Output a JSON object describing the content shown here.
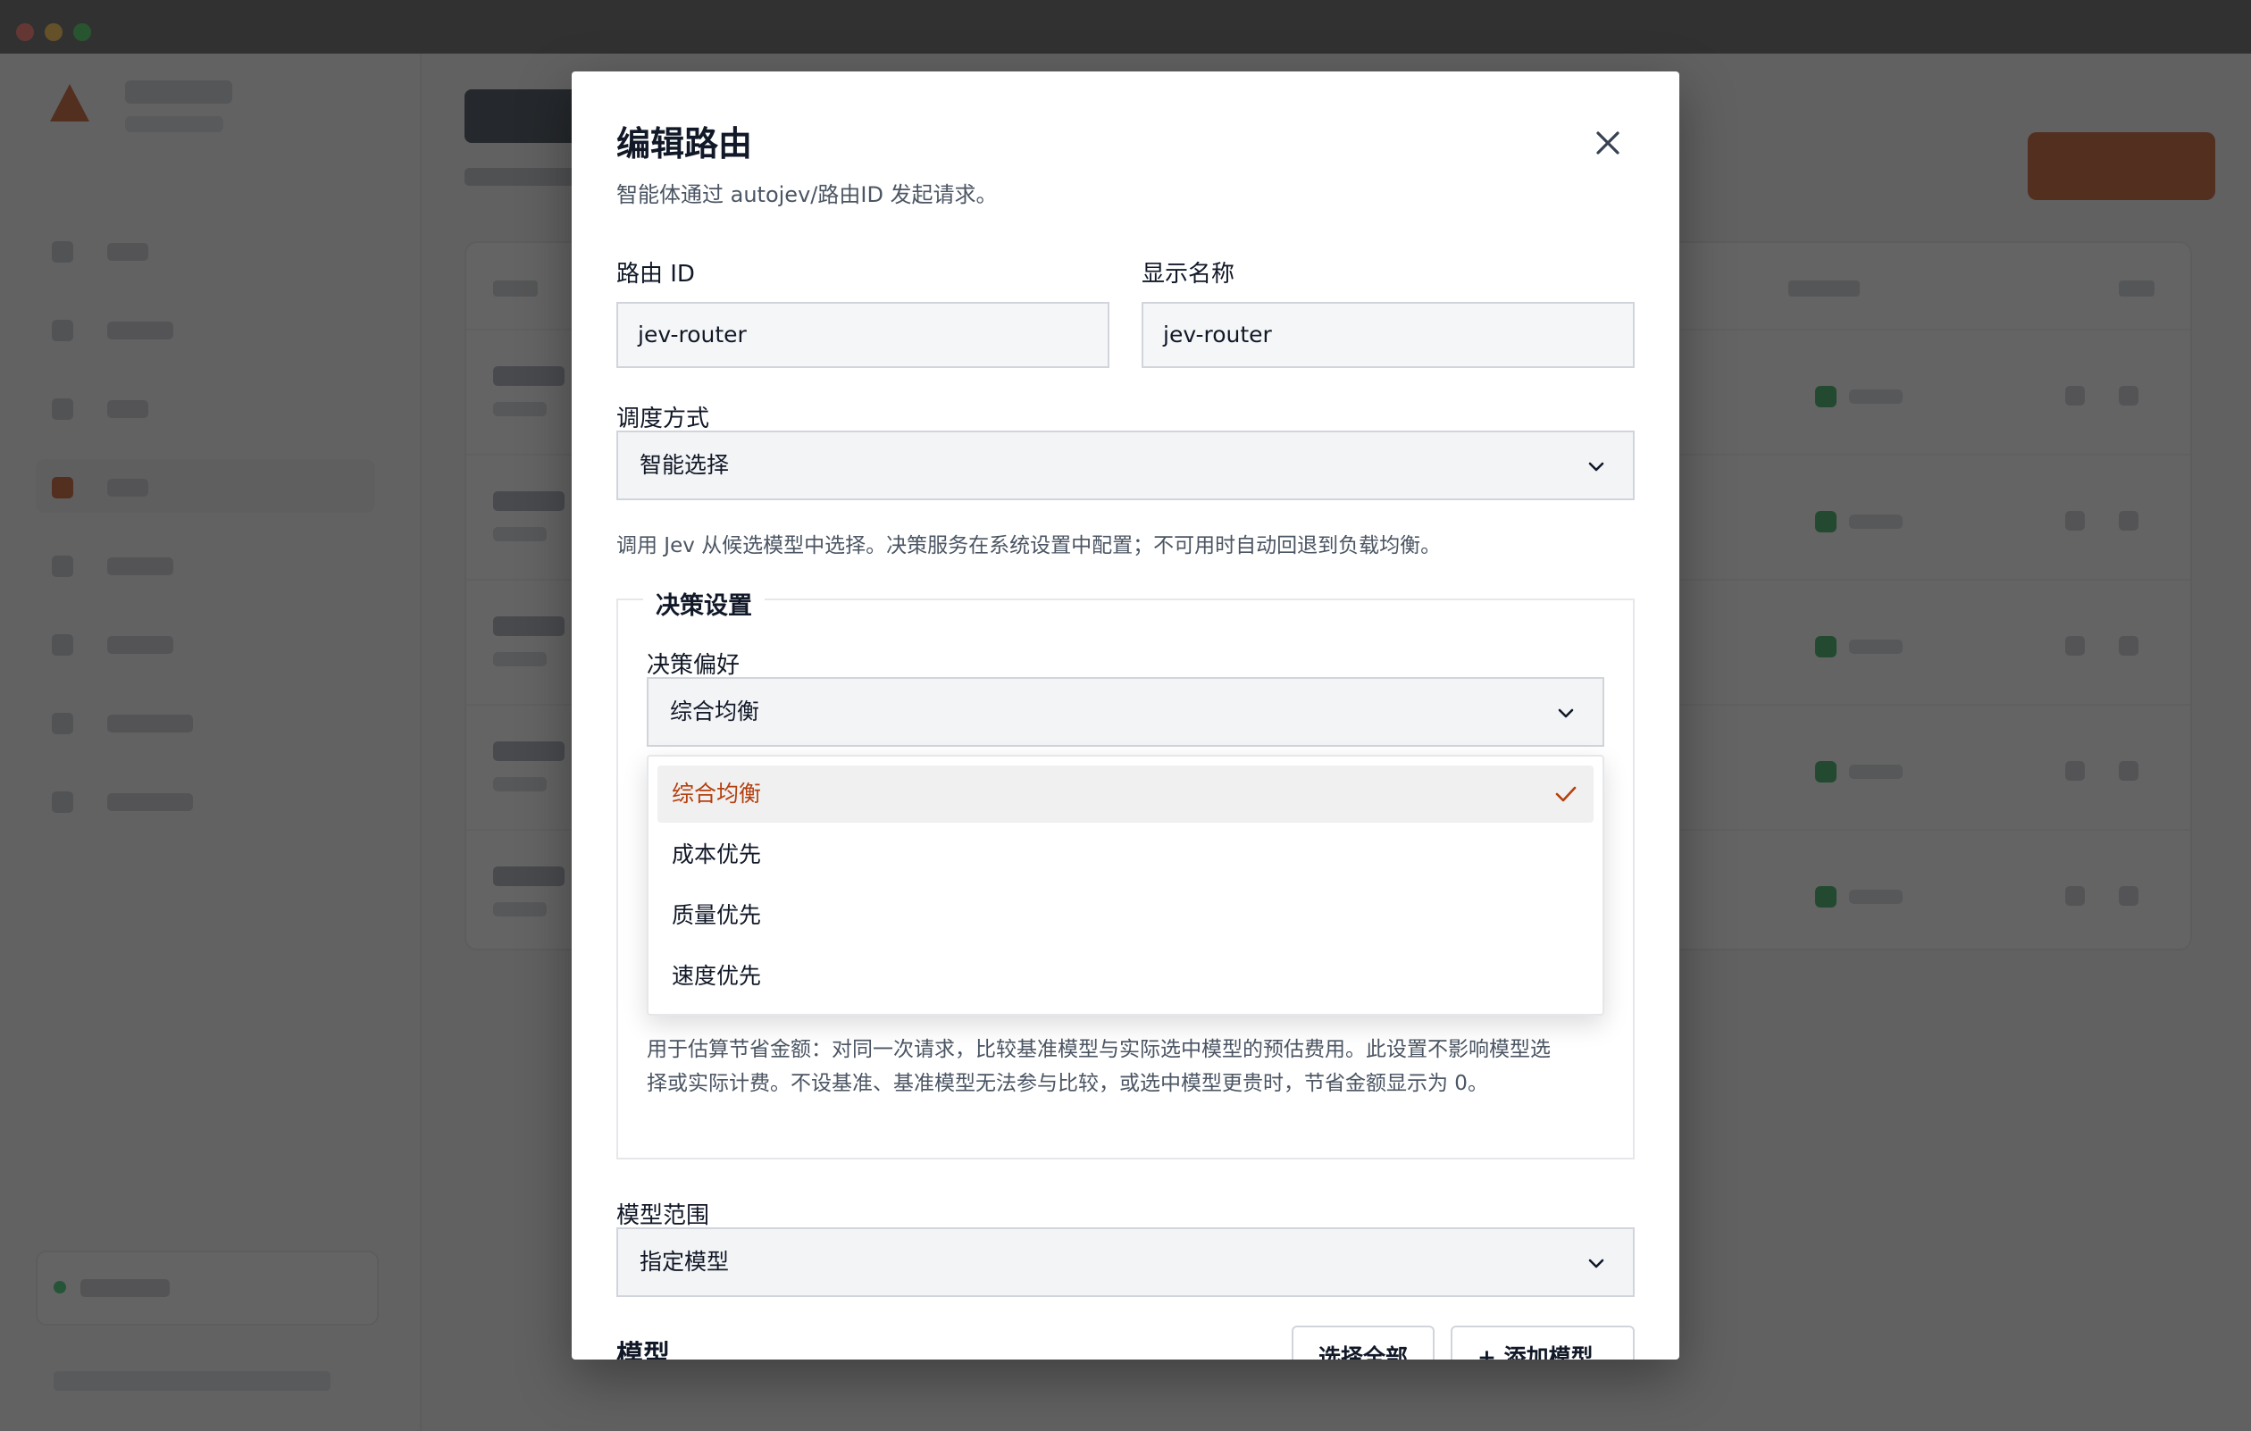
{
  "dialog": {
    "title": "编辑路由",
    "subtitle": "智能体通过 autojev/路由ID 发起请求。",
    "fields": {
      "route_id_label": "路由 ID",
      "route_id_value": "jev-router",
      "display_name_label": "显示名称",
      "display_name_value": "jev-router",
      "dispatch_label": "调度方式",
      "dispatch_value": "智能选择",
      "dispatch_help": "调用 Jev 从候选模型中选择。决策服务在系统设置中配置；不可用时自动回退到负载均衡。"
    },
    "decision": {
      "legend": "决策设置",
      "preference_label": "决策偏好",
      "preference_value": "综合均衡",
      "options": [
        "综合均衡",
        "成本优先",
        "质量优先",
        "速度优先"
      ],
      "selected_index": 0,
      "help_line1": "用于估算节省金额：对同一次请求，比较基准模型与实际选中模型的预估费用。此设置不影响模型选",
      "help_line2": "择或实际计费。不设基准、基准模型无法参与比较，或选中模型更贵时，节省金额显示为 0。"
    },
    "model_scope": {
      "label": "模型范围",
      "value": "指定模型"
    },
    "models": {
      "heading": "模型",
      "select_all_button": "选择全部",
      "add_model_button": "+ 添加模型"
    }
  },
  "colors": {
    "accent": "#c2410c",
    "selected_option_text": "#b5400e",
    "status_ok": "#16a34a"
  },
  "icons": [
    "close-icon",
    "chevron-down-icon",
    "check-icon"
  ]
}
